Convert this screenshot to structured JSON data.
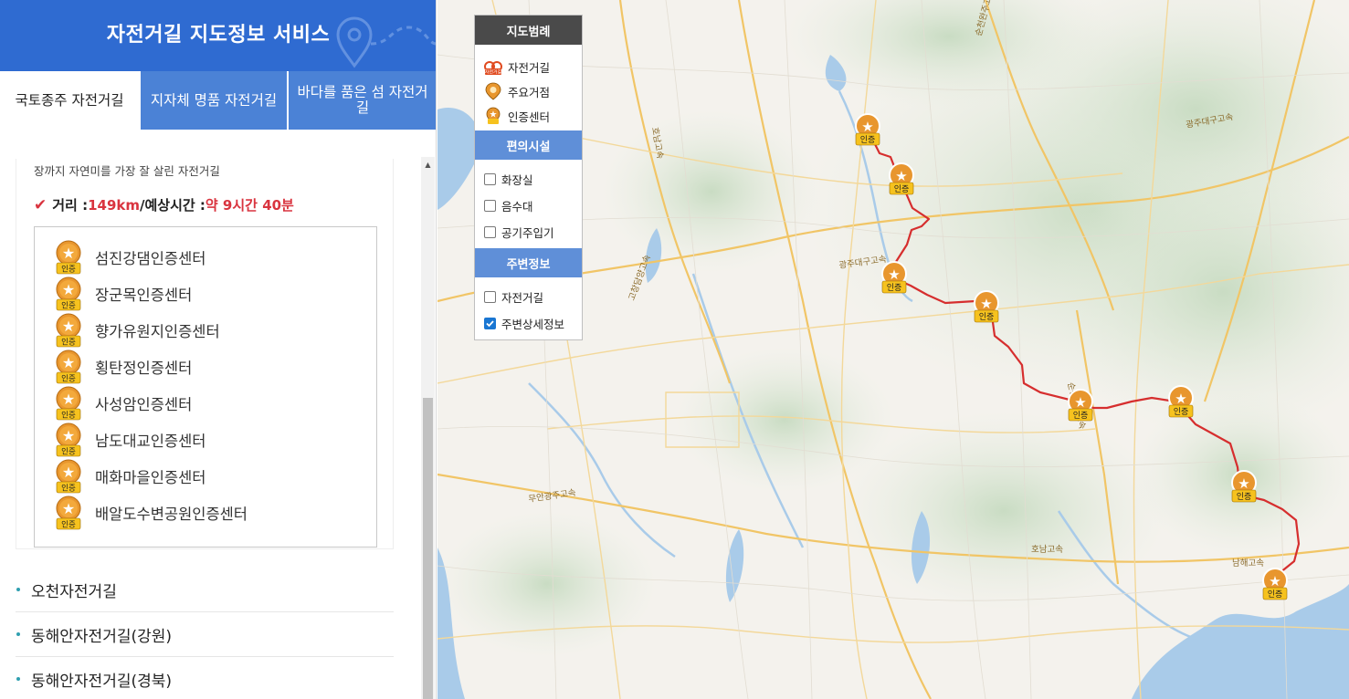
{
  "header": {
    "title": "자전거길 지도정보 서비스"
  },
  "tabs": [
    {
      "label": "국토종주 자전거길",
      "active": true
    },
    {
      "label": "지자체 명품 자전거길",
      "active": false
    },
    {
      "label": "바다를 품은 섬 자전거길",
      "active": false
    }
  ],
  "route": {
    "description": "장까지 자연미를 가장 잘 살린 자전거길",
    "distance_label": "거리 : ",
    "distance_value": "149km",
    "sep": " / ",
    "time_label": "예상시간 : ",
    "time_value": "약 9시간 40분",
    "badge_label": "인증",
    "cert_centers": [
      "섬진강댐인증센터",
      "장군목인증센터",
      "향가유원지인증센터",
      "횡탄정인증센터",
      "사성암인증센터",
      "남도대교인증센터",
      "매화마을인증센터",
      "배알도수변공원인증센터"
    ]
  },
  "route_groups": [
    "오천자전거길",
    "동해안자전거길(강원)",
    "동해안자전거길(경북)"
  ],
  "legend": {
    "title": "지도범례",
    "items": [
      {
        "label": "자전거길",
        "icon": "bike-route-icon"
      },
      {
        "label": "주요거점",
        "icon": "major-point-icon"
      },
      {
        "label": "인증센터",
        "icon": "cert-center-icon"
      }
    ],
    "bike_icon_text": "자전거길",
    "facilities_title": "편의시설",
    "facilities": [
      {
        "label": "화장실",
        "checked": false
      },
      {
        "label": "음수대",
        "checked": false
      },
      {
        "label": "공기주입기",
        "checked": false
      }
    ],
    "nearby_title": "주변정보",
    "nearby": [
      {
        "label": "자전거길",
        "checked": false
      },
      {
        "label": "주변상세정보",
        "checked": true
      }
    ]
  },
  "map": {
    "route_color": "#d62e2e",
    "road_labels": [
      "광주대구고속",
      "순천완주고속",
      "호남고속",
      "남해고속",
      "무안광주고속",
      "고창담양고속",
      "호남고속",
      "광주대구고속",
      "순천완주고속"
    ],
    "marker_label": "인증"
  },
  "colors": {
    "accent": "#2f6bd1",
    "tab_inactive": "#4b82d6",
    "highlight": "#d9343f",
    "legend_blue": "#5f8fd8"
  }
}
